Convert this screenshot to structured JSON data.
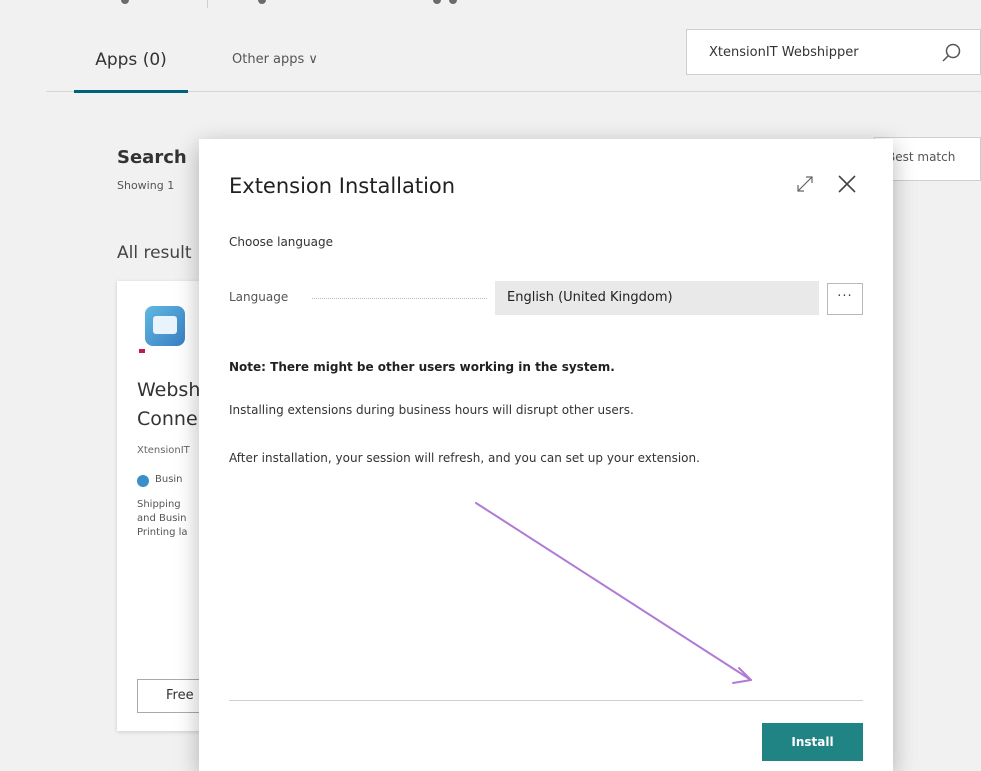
{
  "tabs": {
    "apps_label": "Apps (0)",
    "other_apps_label": "Other apps ∨",
    "search_value": "XtensionIT Webshipper"
  },
  "background": {
    "search_heading": "Search",
    "showing_text": "Showing 1",
    "all_results": "All result",
    "sort_label": "Best match",
    "card": {
      "title_line1": "Websh",
      "title_line2": "Conne",
      "publisher": "XtensionIT",
      "category": "Busin",
      "description_lines": [
        "Shipping",
        "and Busin",
        "Printing la"
      ],
      "free_button": "Free"
    }
  },
  "modal": {
    "title": "Extension Installation",
    "section_label": "Choose language",
    "language_label": "Language",
    "language_value": "English (United Kingdom)",
    "more_button": "···",
    "note": "Note: There might be other users working in the system.",
    "paragraph1": "Installing extensions during business hours will disrupt other users.",
    "paragraph2": "After installation, your session will refresh, and you can set up your extension.",
    "install_button": "Install"
  },
  "colors": {
    "accent": "#00627a",
    "install_button": "#1f8483",
    "annotation_arrow": "#b07ad6"
  }
}
